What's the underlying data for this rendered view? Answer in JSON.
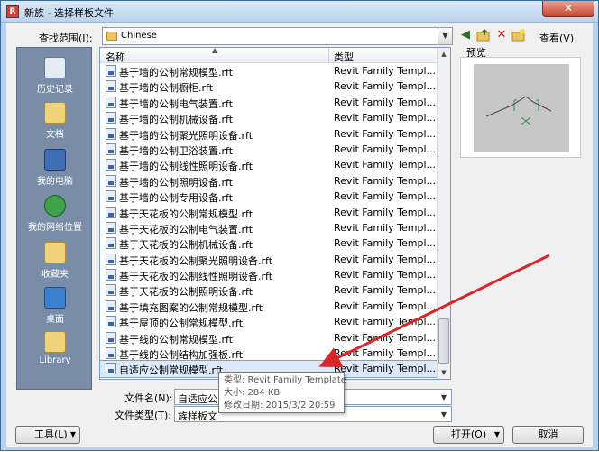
{
  "window": {
    "title": "新族 - 选择样板文件",
    "close": "✕",
    "app_icon": "R"
  },
  "toolbar": {
    "look_in_label": "查找范围(I):",
    "look_in_value": "Chinese",
    "views_label": "查看(V)",
    "icons": [
      "back-icon",
      "up-folder-icon",
      "delete-icon",
      "new-folder-icon",
      "views-icon"
    ]
  },
  "places": [
    {
      "label": "历史记录",
      "icon": "history-icon"
    },
    {
      "label": "文档",
      "icon": "documents-icon"
    },
    {
      "label": "我的电脑",
      "icon": "computer-icon"
    },
    {
      "label": "我的网络位置",
      "icon": "network-icon"
    },
    {
      "label": "收藏夹",
      "icon": "favorites-icon"
    },
    {
      "label": "桌面",
      "icon": "desktop-icon"
    },
    {
      "label": "Library",
      "icon": "library-folder-icon"
    }
  ],
  "columns": {
    "name": "名称",
    "type": "类型"
  },
  "files": [
    {
      "name": "基于墙的公制常规模型.rft",
      "type": "Revit Family Templ..."
    },
    {
      "name": "基于墙的公制橱柜.rft",
      "type": "Revit Family Templ..."
    },
    {
      "name": "基于墙的公制电气装置.rft",
      "type": "Revit Family Templ..."
    },
    {
      "name": "基于墙的公制机械设备.rft",
      "type": "Revit Family Templ..."
    },
    {
      "name": "基于墙的公制聚光照明设备.rft",
      "type": "Revit Family Templ..."
    },
    {
      "name": "基于墙的公制卫浴装置.rft",
      "type": "Revit Family Templ..."
    },
    {
      "name": "基于墙的公制线性照明设备.rft",
      "type": "Revit Family Templ..."
    },
    {
      "name": "基于墙的公制照明设备.rft",
      "type": "Revit Family Templ..."
    },
    {
      "name": "基于墙的公制专用设备.rft",
      "type": "Revit Family Templ..."
    },
    {
      "name": "基于天花板的公制常规模型.rft",
      "type": "Revit Family Templ..."
    },
    {
      "name": "基于天花板的公制电气装置.rft",
      "type": "Revit Family Templ..."
    },
    {
      "name": "基于天花板的公制机械设备.rft",
      "type": "Revit Family Templ..."
    },
    {
      "name": "基于天花板的公制聚光照明设备.rft",
      "type": "Revit Family Templ..."
    },
    {
      "name": "基于天花板的公制线性照明设备.rft",
      "type": "Revit Family Templ..."
    },
    {
      "name": "基于天花板的公制照明设备.rft",
      "type": "Revit Family Templ..."
    },
    {
      "name": "基于填充图案的公制常规模型.rft",
      "type": "Revit Family Templ..."
    },
    {
      "name": "基于屋顶的公制常规模型.rft",
      "type": "Revit Family Templ..."
    },
    {
      "name": "基于线的公制常规模型.rft",
      "type": "Revit Family Templ..."
    },
    {
      "name": "基于线的公制结构加强板.rft",
      "type": "Revit Family Templ..."
    },
    {
      "name": "自适应公制常规模型.rft",
      "type": "Revit Family Templ...",
      "selected": true
    }
  ],
  "preview_label": "预览",
  "tooltip": {
    "type": "类型: Revit Family Template",
    "size": "大小: 284 KB",
    "modified": "修改日期: 2015/3/2 20:59"
  },
  "filename": {
    "label": "文件名(N):",
    "value": "自适应公"
  },
  "filetype": {
    "label": "文件类型(T):",
    "value": "族样板文"
  },
  "buttons": {
    "tools": "工具(L)",
    "open": "打开(O)",
    "cancel": "取消"
  },
  "colors": {
    "window_border": "#3c6a96",
    "places_bg": "#7a8da8",
    "arrow": "#d8262a",
    "selection": "#dbe9fb"
  }
}
